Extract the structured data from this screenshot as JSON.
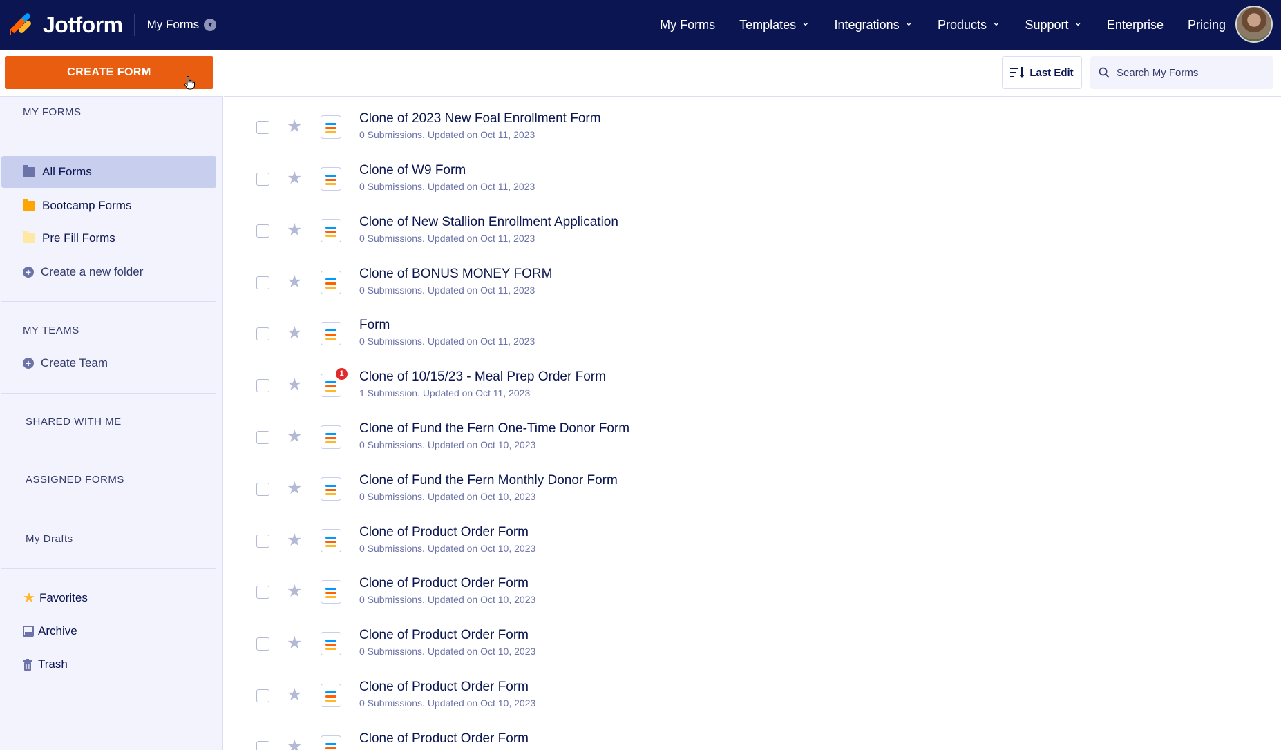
{
  "topbar": {
    "brand": "Jotform",
    "context_label": "My Forms",
    "nav": [
      {
        "label": "My Forms",
        "dropdown": false
      },
      {
        "label": "Templates",
        "dropdown": true
      },
      {
        "label": "Integrations",
        "dropdown": true
      },
      {
        "label": "Products",
        "dropdown": true
      },
      {
        "label": "Support",
        "dropdown": true
      },
      {
        "label": "Enterprise",
        "dropdown": false
      },
      {
        "label": "Pricing",
        "dropdown": false
      }
    ]
  },
  "sidebar": {
    "create_button": "CREATE FORM",
    "my_forms_title": "MY FORMS",
    "folders": [
      {
        "label": "All Forms",
        "color": "#6c73a8",
        "active": true
      },
      {
        "label": "Bootcamp Forms",
        "color": "#ffa500",
        "active": false
      },
      {
        "label": "Pre Fill Forms",
        "color": "#ffe8a3",
        "active": false
      }
    ],
    "create_folder": "Create a new folder",
    "my_teams_title": "MY TEAMS",
    "create_team": "Create Team",
    "shared_title": "SHARED WITH ME",
    "assigned_title": "ASSIGNED FORMS",
    "drafts": "My Drafts",
    "favorites": "Favorites",
    "archive": "Archive",
    "trash": "Trash"
  },
  "toolbar": {
    "sort_label": "Last Edit",
    "search_placeholder": "Search My Forms"
  },
  "forms": [
    {
      "title": "Clone of 2023 New Foal Enrollment Form",
      "meta": "0 Submissions. Updated on Oct 11, 2023"
    },
    {
      "title": "Clone of W9 Form",
      "meta": "0 Submissions. Updated on Oct 11, 2023"
    },
    {
      "title": "Clone of New Stallion Enrollment Application",
      "meta": "0 Submissions. Updated on Oct 11, 2023"
    },
    {
      "title": "Clone of BONUS MONEY FORM",
      "meta": "0 Submissions. Updated on Oct 11, 2023"
    },
    {
      "title": "Form",
      "meta": "0 Submissions. Updated on Oct 11, 2023"
    },
    {
      "title": "Clone of 10/15/23 - Meal Prep Order Form",
      "meta": "1 Submission. Updated on Oct 11, 2023",
      "badge": "1"
    },
    {
      "title": "Clone of Fund the Fern One-Time Donor Form",
      "meta": "0 Submissions. Updated on Oct 10, 2023"
    },
    {
      "title": "Clone of Fund the Fern Monthly Donor Form",
      "meta": "0 Submissions. Updated on Oct 10, 2023"
    },
    {
      "title": "Clone of Product Order Form",
      "meta": "0 Submissions. Updated on Oct 10, 2023"
    },
    {
      "title": "Clone of Product Order Form",
      "meta": "0 Submissions. Updated on Oct 10, 2023"
    },
    {
      "title": "Clone of Product Order Form",
      "meta": "0 Submissions. Updated on Oct 10, 2023"
    },
    {
      "title": "Clone of Product Order Form",
      "meta": "0 Submissions. Updated on Oct 10, 2023"
    },
    {
      "title": "Clone of Product Order Form",
      "meta": ""
    }
  ],
  "colors": {
    "navy": "#0a1551",
    "accent_orange": "#e85d0f",
    "sidebar_bg": "#f3f3fe",
    "active_bg": "#c8ceed"
  }
}
